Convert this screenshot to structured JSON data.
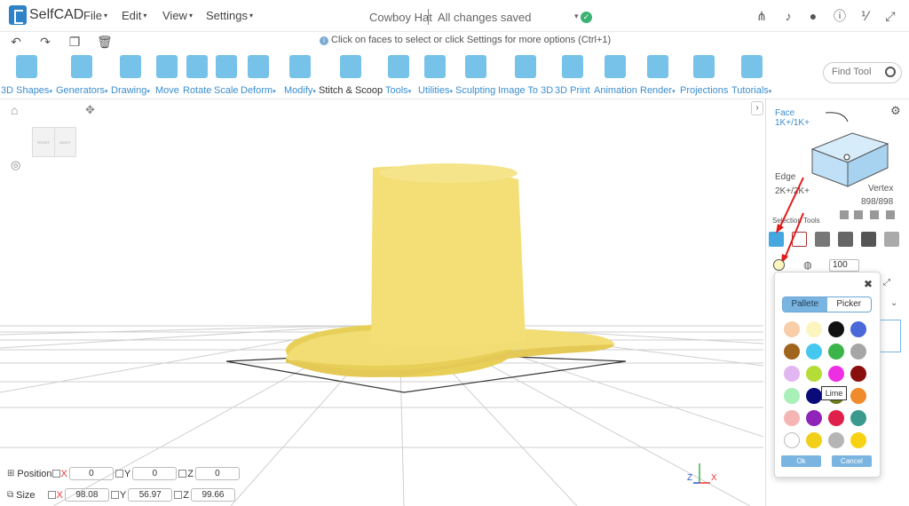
{
  "app": {
    "name": "SelfCAD"
  },
  "menu": {
    "file": "File",
    "edit": "Edit",
    "view": "View",
    "settings": "Settings"
  },
  "document": {
    "title": "Cowboy Hat",
    "status": "All changes saved"
  },
  "hint": "Click on faces to select or click Settings for more options (Ctrl+1)",
  "toolbar": {
    "items": [
      {
        "label": "3D Shapes",
        "dropdown": true
      },
      {
        "label": "Generators",
        "dropdown": true
      },
      {
        "label": "Drawing",
        "dropdown": true
      },
      {
        "label": "Move"
      },
      {
        "label": "Rotate"
      },
      {
        "label": "Scale"
      },
      {
        "label": "Deform",
        "dropdown": true
      },
      {
        "label": "Modify",
        "dropdown": true
      },
      {
        "label": "Stitch & Scoop"
      },
      {
        "label": "Tools",
        "dropdown": true
      },
      {
        "label": "Utilities",
        "dropdown": true
      },
      {
        "label": "Sculpting"
      },
      {
        "label": "Image To 3D"
      },
      {
        "label": "3D Print"
      },
      {
        "label": "Animation"
      },
      {
        "label": "Render",
        "dropdown": true
      },
      {
        "label": "Projections"
      },
      {
        "label": "Tutorials",
        "dropdown": true
      }
    ],
    "find_tool_placeholder": "Find Tool"
  },
  "viewcube": {
    "front": "FRONT",
    "right": "RIGHT"
  },
  "transform": {
    "position_label": "Position",
    "size_label": "Size",
    "axes": [
      "X",
      "Y",
      "Z"
    ],
    "position": [
      "0",
      "0",
      "0"
    ],
    "size": [
      "98.08",
      "56.97",
      "99.66"
    ]
  },
  "axis_gizmo": {
    "z": "Z",
    "x": "X"
  },
  "panel": {
    "face_label": "Face",
    "face_counts": "1K+/1K+",
    "edge_label": "Edge",
    "edge_counts": "2K+/2K+",
    "vertex_label": "Vertex",
    "vertex_counts": "898/898",
    "selection_tools_label": "Selection Tools",
    "opacity_value": "100"
  },
  "color_popup": {
    "tab_palette": "Pallete",
    "tab_picker": "Picker",
    "tooltip": "Lime",
    "ok": "Ok",
    "cancel": "Cancel",
    "swatches": [
      "#f8cda8",
      "#fdf5c0",
      "#111111",
      "#4a68d8",
      "#a0651c",
      "#45c8f0",
      "#3bb54a",
      "#a6a6a6",
      "#e2b6f0",
      "#b5dd38",
      "#ee2ee3",
      "#8b0e0e",
      "#a9efb8",
      "#0a0a78",
      "#6b7d1a",
      "#f08a2a",
      "#f5b5b5",
      "#8e24b8",
      "#e0204a",
      "#3a9a8e",
      "#ffffff",
      "#f2d01a",
      "#b5b5b5",
      "#f7d214"
    ]
  },
  "model": {
    "color": "#f5e27a"
  }
}
